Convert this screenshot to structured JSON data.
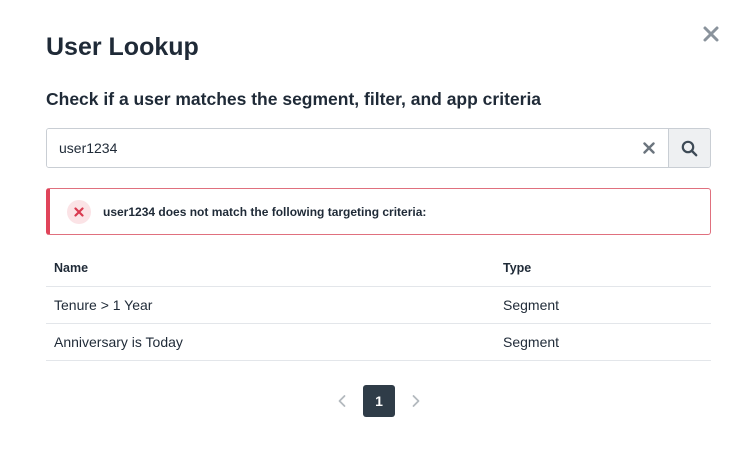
{
  "modal": {
    "title": "User Lookup",
    "subtitle": "Check if a user matches the segment, filter, and app criteria",
    "close_icon": "close-icon"
  },
  "search": {
    "value": "user1234",
    "placeholder": "",
    "clear_icon": "clear-icon",
    "search_icon": "search-icon"
  },
  "alert": {
    "icon": "error-x-icon",
    "message": "user1234 does not match the following targeting criteria:",
    "colors": {
      "border": "#e0445a",
      "icon_bg": "#fbe3e6"
    }
  },
  "table": {
    "headers": {
      "name": "Name",
      "type": "Type"
    },
    "rows": [
      {
        "name": "Tenure > 1 Year",
        "type": "Segment"
      },
      {
        "name": "Anniversary is Today",
        "type": "Segment"
      }
    ]
  },
  "pagination": {
    "current_page": "1",
    "prev_icon": "chevron-left-icon",
    "next_icon": "chevron-right-icon",
    "active_color": "#2f3c48"
  }
}
